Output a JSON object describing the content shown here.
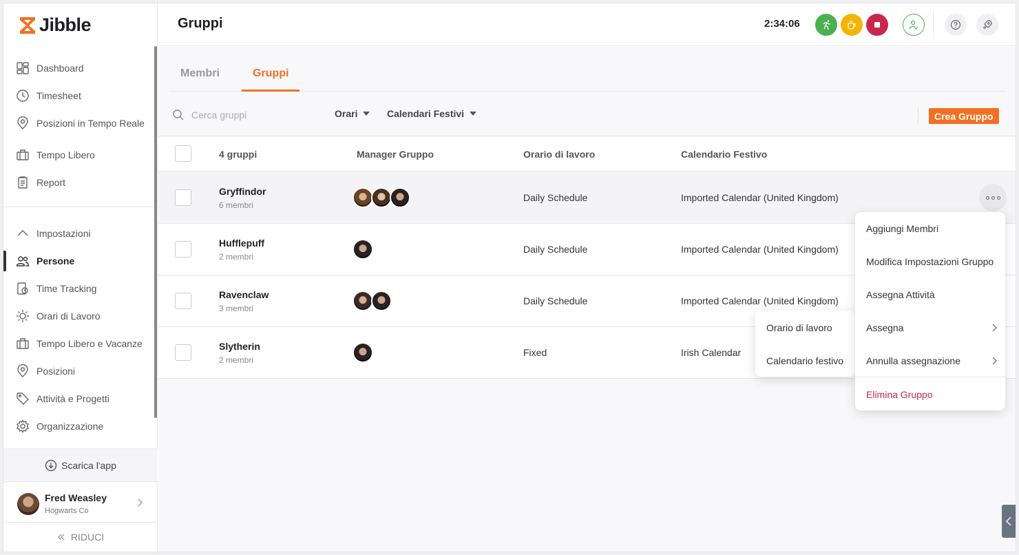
{
  "brand": {
    "name": "Jibble",
    "accent": "#f36f21"
  },
  "sidebar": {
    "items": [
      {
        "label": "Dashboard",
        "icon": "dashboard-icon"
      },
      {
        "label": "Timesheet",
        "icon": "clock-icon"
      },
      {
        "label": "Posizioni in Tempo Reale",
        "icon": "location-pin-icon"
      },
      {
        "label": "Tempo Libero",
        "icon": "briefcase-icon"
      },
      {
        "label": "Report",
        "icon": "report-icon"
      }
    ],
    "settings_label": "Impostazioni",
    "settings_items": [
      {
        "label": "Persone",
        "icon": "people-icon",
        "active": true
      },
      {
        "label": "Time Tracking",
        "icon": "time-tracking-icon"
      },
      {
        "label": "Orari di Lavoro",
        "icon": "work-schedule-icon"
      },
      {
        "label": "Tempo Libero e Vacanze",
        "icon": "briefcase-icon"
      },
      {
        "label": "Posizioni",
        "icon": "location-pin-icon"
      },
      {
        "label": "Attività e Progetti",
        "icon": "tag-icon"
      },
      {
        "label": "Organizzazione",
        "icon": "gear-icon"
      }
    ],
    "download_label": "Scarica l'app",
    "user": {
      "name": "Fred Weasley",
      "org": "Hogwarts Co"
    },
    "reduce_label": "RIDUCI"
  },
  "header": {
    "title": "Gruppi",
    "timer": "2:34:06",
    "colors": {
      "start": "#4caf50",
      "break": "#f5b400",
      "stop": "#c8284e",
      "user": "#4caf50"
    }
  },
  "tabs": [
    {
      "label": "Membri",
      "active": false
    },
    {
      "label": "Gruppi",
      "active": true
    }
  ],
  "toolbar": {
    "search_placeholder": "Cerca gruppi",
    "search_value": "",
    "filter_schedules": "Orari",
    "filter_holidays": "Calendari Festivi",
    "create_label": "Crea Gruppo"
  },
  "table": {
    "headers": {
      "name": "4 gruppi",
      "manager": "Manager Gruppo",
      "schedule": "Orario di lavoro",
      "calendar": "Calendario Festivo"
    },
    "rows": [
      {
        "name": "Gryffindor",
        "members": "6 membri",
        "schedule": "Daily Schedule",
        "calendar": "Imported Calendar (United Kingdom)",
        "avatars": 3
      },
      {
        "name": "Hufflepuff",
        "members": "2 membri",
        "schedule": "Daily Schedule",
        "calendar": "Imported Calendar (United Kingdom)",
        "avatars": 1
      },
      {
        "name": "Ravenclaw",
        "members": "3 membri",
        "schedule": "Daily Schedule",
        "calendar": "Imported Calendar (United Kingdom)",
        "avatars": 2
      },
      {
        "name": "Slytherin",
        "members": "2 membri",
        "schedule": "Fixed",
        "calendar": "Irish Calendar",
        "avatars": 1
      }
    ]
  },
  "context_menu": {
    "items": [
      {
        "label": "Aggiungi Membri"
      },
      {
        "label": "Modifica Impostazioni Gruppo"
      },
      {
        "label": "Assegna Attività"
      },
      {
        "label": "Assegna"
      },
      {
        "label": "Annulla assegnazione"
      }
    ],
    "danger_label": "Elimina Gruppo"
  },
  "submenu": {
    "items": [
      {
        "label": "Orario di lavoro"
      },
      {
        "label": "Calendario festivo"
      }
    ]
  }
}
